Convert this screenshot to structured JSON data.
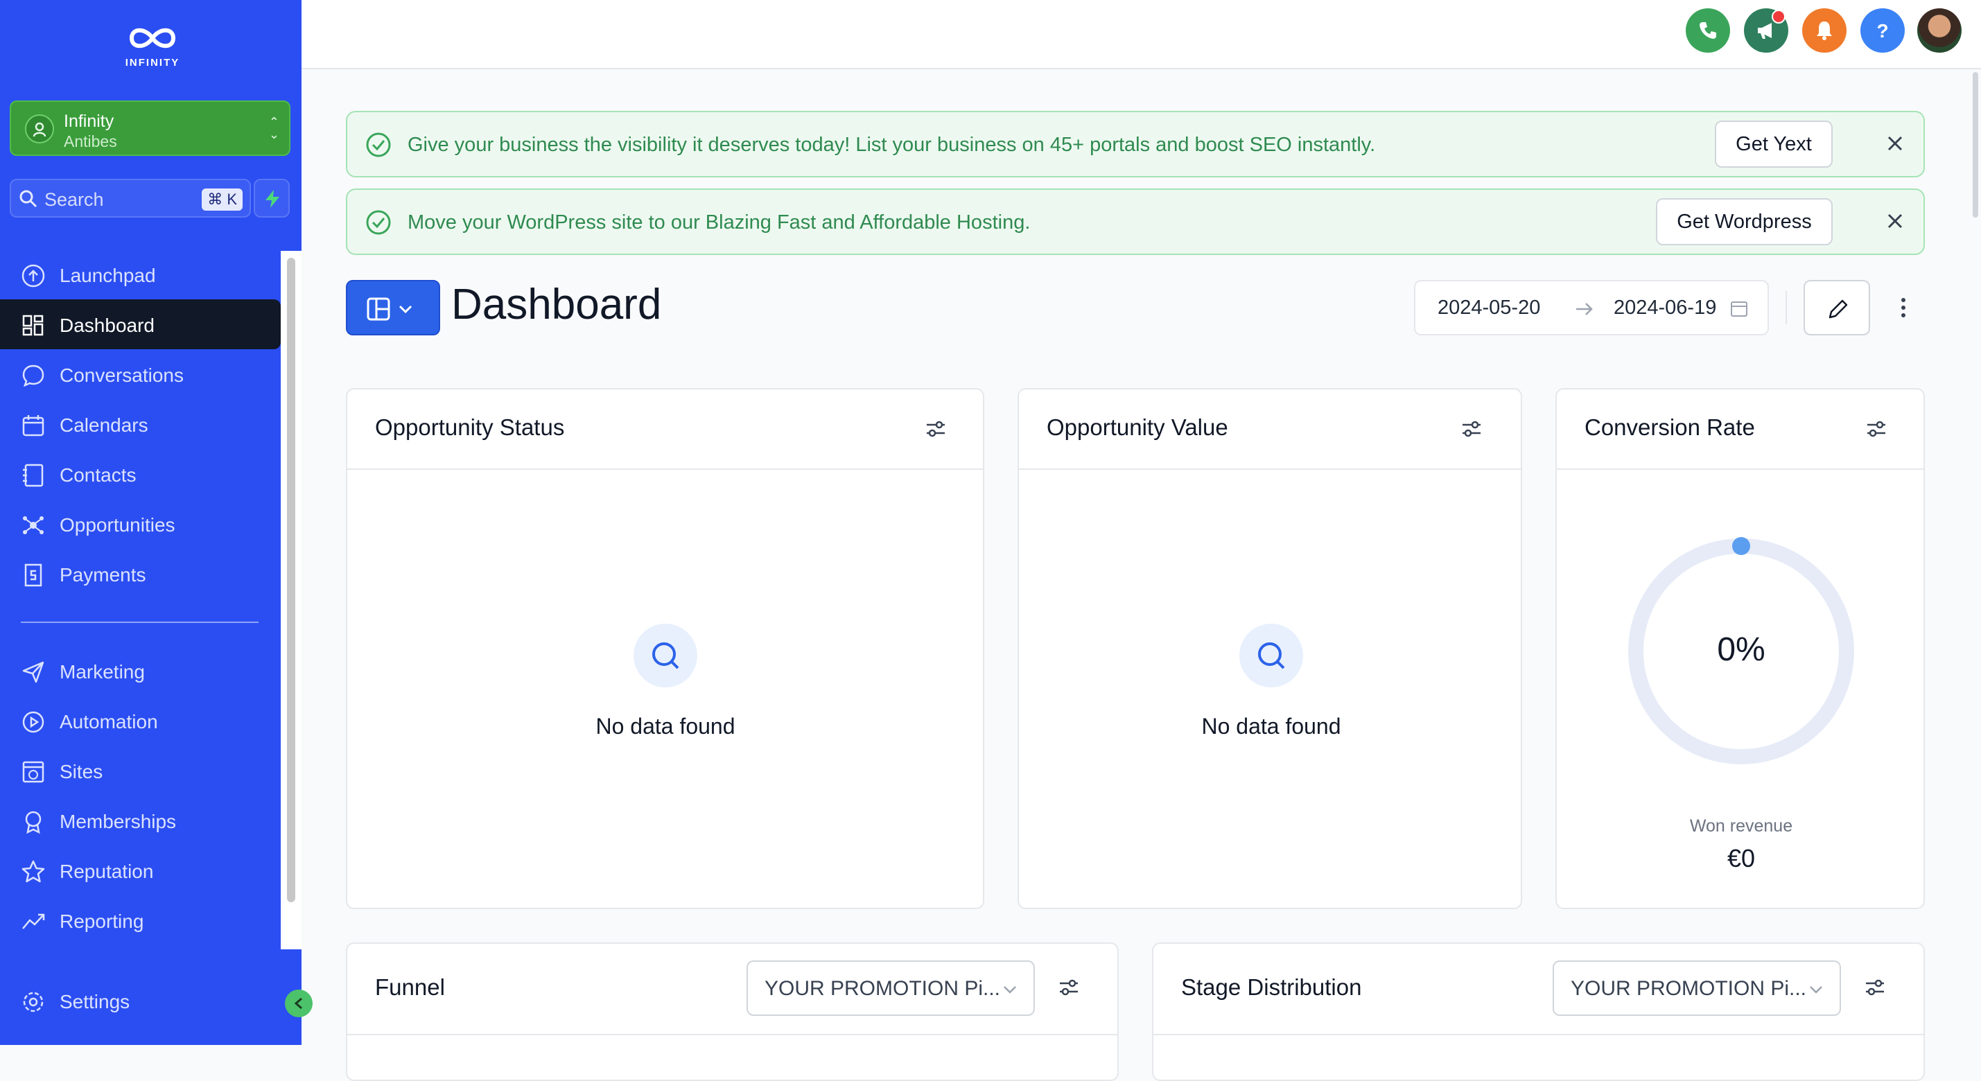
{
  "app": {
    "logo_text": "INFINITY",
    "account": {
      "name": "Infinity",
      "location": "Antibes"
    },
    "search": {
      "placeholder": "Search",
      "shortcut": "⌘ K"
    }
  },
  "sidebar": {
    "items": [
      {
        "label": "Launchpad",
        "icon": "launchpad-icon"
      },
      {
        "label": "Dashboard",
        "icon": "dashboard-grid-icon",
        "active": true
      },
      {
        "label": "Conversations",
        "icon": "chat-bubble-icon"
      },
      {
        "label": "Calendars",
        "icon": "calendar-icon"
      },
      {
        "label": "Contacts",
        "icon": "contacts-book-icon"
      },
      {
        "label": "Opportunities",
        "icon": "opportunities-icon"
      },
      {
        "label": "Payments",
        "icon": "payments-icon"
      }
    ],
    "items2": [
      {
        "label": "Marketing",
        "icon": "send-icon"
      },
      {
        "label": "Automation",
        "icon": "play-circle-icon"
      },
      {
        "label": "Sites",
        "icon": "globe-window-icon"
      },
      {
        "label": "Memberships",
        "icon": "badge-icon"
      },
      {
        "label": "Reputation",
        "icon": "star-icon"
      },
      {
        "label": "Reporting",
        "icon": "trend-icon"
      }
    ],
    "settings": {
      "label": "Settings",
      "icon": "gear-icon"
    }
  },
  "topbar": {
    "icons": [
      "phone-icon",
      "megaphone-icon",
      "bell-icon",
      "help-icon",
      "user-avatar"
    ],
    "colors": {
      "phone": "#3aa55a",
      "megaphone": "#2f7f5e",
      "bell": "#f07a2a",
      "help": "#3b82f6"
    }
  },
  "banners": [
    {
      "text": "Give your business the visibility it deserves today! List your business on 45+ portals and boost SEO instantly.",
      "button": "Get Yext"
    },
    {
      "text": "Move your WordPress site to our Blazing Fast and Affordable Hosting.",
      "button": "Get Wordpress"
    }
  ],
  "header": {
    "title": "Dashboard",
    "date_start": "2024-05-20",
    "date_end": "2024-06-19"
  },
  "cards": {
    "opportunity_status": {
      "title": "Opportunity Status",
      "empty": "No data found"
    },
    "opportunity_value": {
      "title": "Opportunity Value",
      "empty": "No data found"
    },
    "conversion_rate": {
      "title": "Conversion Rate",
      "value": "0%",
      "won_label": "Won revenue",
      "won_value": "€0"
    },
    "funnel": {
      "title": "Funnel",
      "pipeline": "YOUR PROMOTION Pi..."
    },
    "stage_distribution": {
      "title": "Stage Distribution",
      "pipeline": "YOUR PROMOTION Pi..."
    }
  },
  "colors": {
    "sidebar": "#2b4ef2",
    "accent": "#2b62e8",
    "success_banner": "#edf9f0"
  }
}
